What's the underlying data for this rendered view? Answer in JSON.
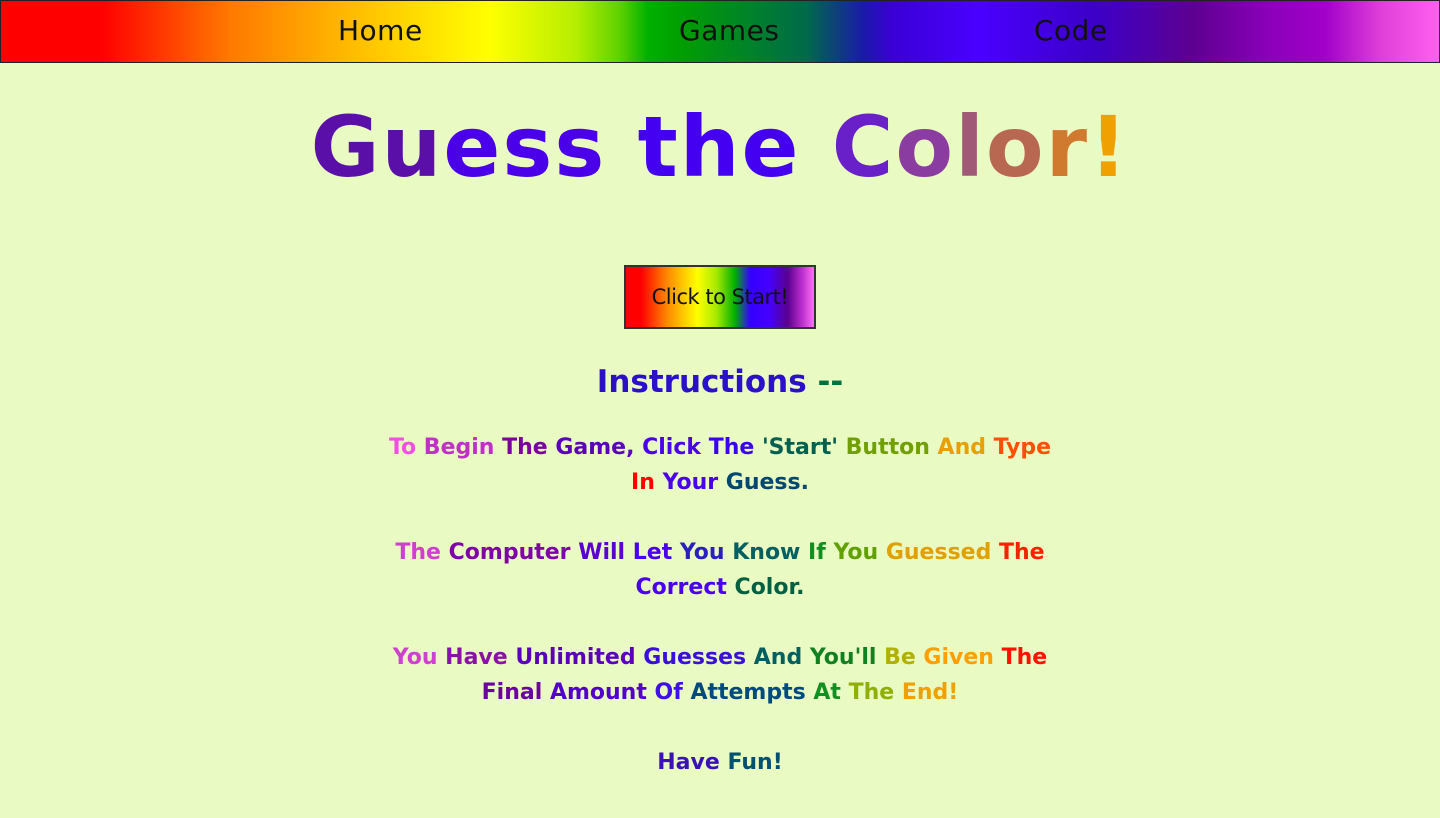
{
  "nav": {
    "home": "Home",
    "games": "Games",
    "code": "Code"
  },
  "title": {
    "words": [
      {
        "text": "Gu",
        "color": "#5a10a8"
      },
      {
        "text": "ess ",
        "color": "#4a00e8"
      },
      {
        "text": "the ",
        "color": "#4400f0"
      },
      {
        "text": "C",
        "color": "#6a20c8"
      },
      {
        "text": "o",
        "color": "#8a3ca0"
      },
      {
        "text": "l",
        "color": "#a05a78"
      },
      {
        "text": "o",
        "color": "#b86850"
      },
      {
        "text": "r",
        "color": "#d07a30"
      },
      {
        "text": "!",
        "color": "#f0a000"
      }
    ]
  },
  "start_button": "Click to Start!",
  "instructions": {
    "heading": [
      {
        "text": "Instructions ",
        "color": "#2a10c8"
      },
      {
        "text": "--",
        "color": "#007040"
      }
    ],
    "paragraphs": [
      [
        {
          "text": "To ",
          "color": "#f050e0"
        },
        {
          "text": "Begin ",
          "color": "#c030c8"
        },
        {
          "text": "The ",
          "color": "#7a0098"
        },
        {
          "text": "Game, ",
          "color": "#5a00b8"
        },
        {
          "text": "Click ",
          "color": "#4a00e8"
        },
        {
          "text": "The ",
          "color": "#3a00f0"
        },
        {
          "text": "'Start' ",
          "color": "#006050"
        },
        {
          "text": "Button ",
          "color": "#70a000"
        },
        {
          "text": "And ",
          "color": "#e8a000"
        },
        {
          "text": "Type ",
          "color": "#ff5000"
        },
        {
          "text": "In ",
          "color": "#ff0000"
        },
        {
          "text": "Your ",
          "color": "#4a00e8"
        },
        {
          "text": "Guess.",
          "color": "#004870"
        }
      ],
      [
        {
          "text": "The ",
          "color": "#d040d0"
        },
        {
          "text": "Computer ",
          "color": "#8000a8"
        },
        {
          "text": "Will ",
          "color": "#5a00d0"
        },
        {
          "text": "Let ",
          "color": "#4a00f0"
        },
        {
          "text": "You ",
          "color": "#2a20c0"
        },
        {
          "text": "Know ",
          "color": "#006060"
        },
        {
          "text": "If ",
          "color": "#109020"
        },
        {
          "text": "You ",
          "color": "#60a000"
        },
        {
          "text": "Guessed ",
          "color": "#e0a000"
        },
        {
          "text": "The ",
          "color": "#ff2000"
        },
        {
          "text": "Correct ",
          "color": "#4a00f0"
        },
        {
          "text": "Color.",
          "color": "#006040"
        }
      ],
      [
        {
          "text": "You ",
          "color": "#d040d0"
        },
        {
          "text": "Have ",
          "color": "#8a10a8"
        },
        {
          "text": "Unlimited ",
          "color": "#5a00b8"
        },
        {
          "text": "Guesses ",
          "color": "#3a10d8"
        },
        {
          "text": "And ",
          "color": "#006060"
        },
        {
          "text": "You'll ",
          "color": "#108020"
        },
        {
          "text": "Be ",
          "color": "#b0b000"
        },
        {
          "text": "Given ",
          "color": "#ffa000"
        },
        {
          "text": "The ",
          "color": "#ff1000"
        },
        {
          "text": "Final ",
          "color": "#6a00a0"
        },
        {
          "text": "Amount ",
          "color": "#5000c8"
        },
        {
          "text": "Of ",
          "color": "#4010e8"
        },
        {
          "text": "Attempts ",
          "color": "#004a80"
        },
        {
          "text": "At ",
          "color": "#109020"
        },
        {
          "text": "The ",
          "color": "#90b000"
        },
        {
          "text": "End!",
          "color": "#f0a000"
        }
      ],
      [
        {
          "text": "Have ",
          "color": "#3a10b8"
        },
        {
          "text": "Fun!",
          "color": "#005070"
        }
      ]
    ]
  }
}
